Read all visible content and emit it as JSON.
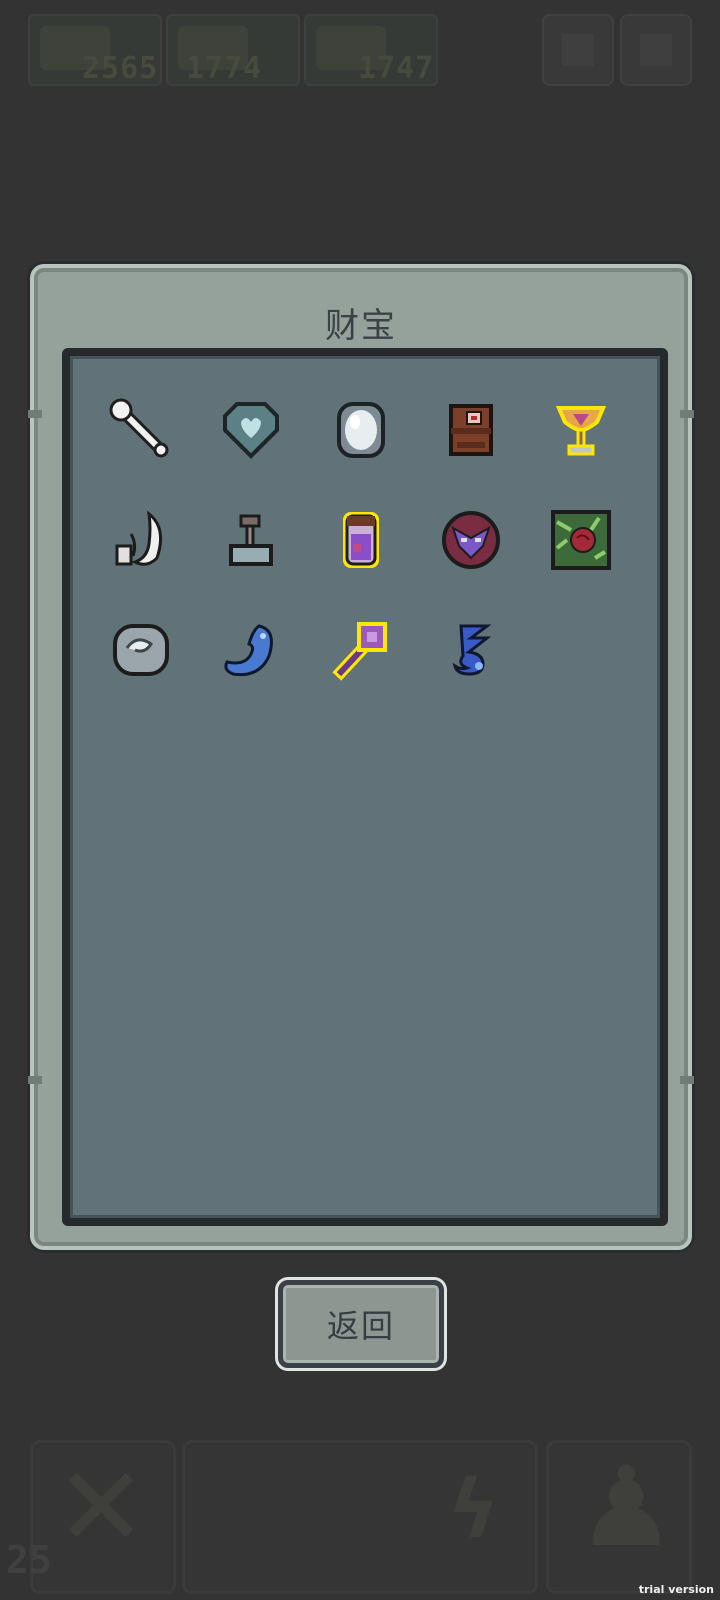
{
  "hud": {
    "resources": [
      {
        "icon": "skull-pile-icon",
        "value": "2565"
      },
      {
        "icon": "bat-wing-icon",
        "value": "1774"
      },
      {
        "icon": "rune-sword-icon",
        "value": "1747"
      }
    ],
    "buttons": [
      "menu-icon",
      "settings-icon"
    ],
    "level": "25"
  },
  "modal": {
    "title": "财宝",
    "items": [
      {
        "name": "bone-icon",
        "framed": false
      },
      {
        "name": "heart-gem-icon",
        "framed": false
      },
      {
        "name": "mirror-stone-icon",
        "framed": false
      },
      {
        "name": "totem-idol-icon",
        "framed": false
      },
      {
        "name": "golden-chalice-icon",
        "framed": true
      },
      {
        "name": "white-claw-icon",
        "framed": false
      },
      {
        "name": "lever-switch-icon",
        "framed": false
      },
      {
        "name": "potion-jar-icon",
        "framed": true
      },
      {
        "name": "demon-orb-icon",
        "framed": false
      },
      {
        "name": "rose-tapestry-icon",
        "framed": false
      },
      {
        "name": "swirl-stone-icon",
        "framed": false
      },
      {
        "name": "blue-spirit-icon",
        "framed": false
      },
      {
        "name": "purple-key-icon",
        "framed": true
      },
      {
        "name": "blue-serpent-icon",
        "framed": false
      }
    ],
    "back_label": "返回"
  },
  "watermark": "trial version"
}
